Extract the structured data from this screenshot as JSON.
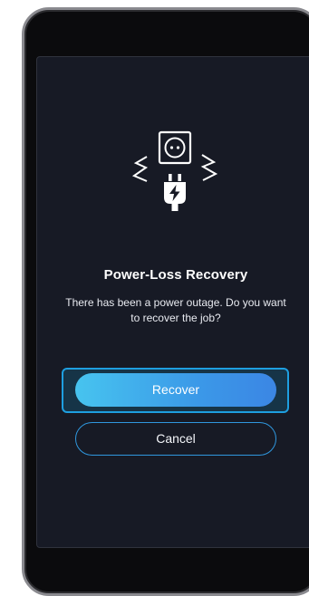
{
  "dialog": {
    "title": "Power-Loss Recovery",
    "message": "There has been a power outage. Do you want to recover the job?",
    "icon": "power-plug-outage-icon"
  },
  "buttons": {
    "recover_label": "Recover",
    "cancel_label": "Cancel"
  },
  "colors": {
    "screen_bg": "#171a25",
    "accent": "#3b99e8",
    "focus_border": "#1e9fe0"
  }
}
